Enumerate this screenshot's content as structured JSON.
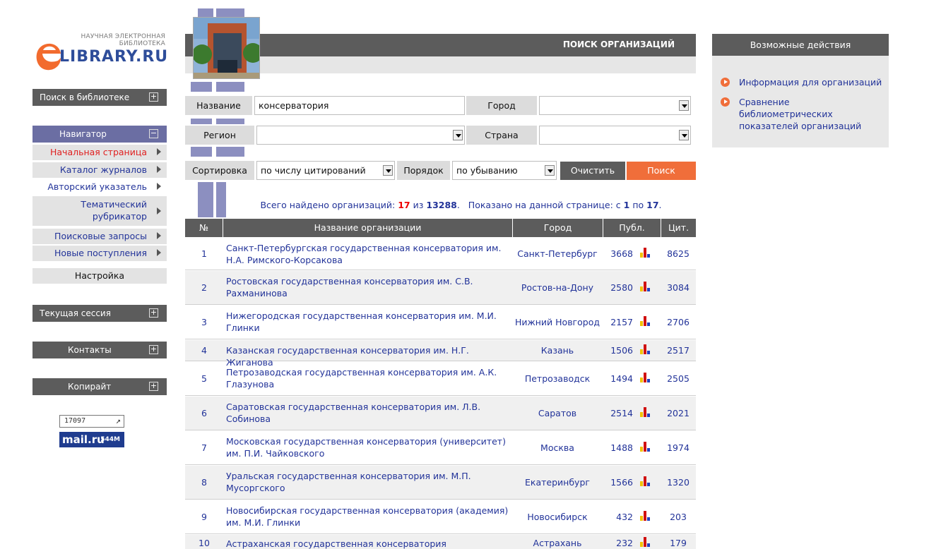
{
  "logo": {
    "small_line1": "НАУЧНАЯ ЭЛЕКТРОННАЯ",
    "small_line2": "БИБЛИОТЕКА",
    "big": "LIBRARY.RU"
  },
  "left_panel": {
    "search_library": "Поиск в библиотеке",
    "navigator": "Навигатор",
    "nav_items": [
      {
        "label": "Начальная страница"
      },
      {
        "label": "Каталог журналов"
      },
      {
        "label": "Авторский указатель"
      },
      {
        "label": "Тематический рубрикатор"
      },
      {
        "label": "Поисковые запросы"
      },
      {
        "label": "Новые поступления"
      }
    ],
    "settings": "Настройка",
    "current_session": "Текущая сессия",
    "contacts": "Контакты",
    "copyright": "Копирайт",
    "counter_value": "17097",
    "mail_logo": "mail.ru",
    "mail_count": "544M"
  },
  "header": {
    "title": "ПОИСК ОРГАНИЗАЦИЙ"
  },
  "form": {
    "name_label": "Название",
    "name_value": "консерватория",
    "city_label": "Город",
    "city_value": "",
    "region_label": "Регион",
    "region_value": "",
    "country_label": "Страна",
    "country_value": "",
    "sort_label": "Сортировка",
    "sort_value": "по числу цитирований",
    "order_label": "Порядок",
    "order_value": "по убыванию",
    "clear_button": "Очистить",
    "search_button": "Поиск"
  },
  "summary": {
    "found_prefix": "Всего найдено организаций:",
    "found_count": "17",
    "of": "из",
    "total": "13288",
    "shown_prefix": "Показано на данной странице: с",
    "from": "1",
    "to_word": "по",
    "to": "17"
  },
  "table": {
    "columns": [
      "№",
      "Название организации",
      "Город",
      "Публ.",
      "Цит."
    ],
    "rows": [
      {
        "num": "1",
        "name": "Санкт-Петербургская государственная консерватория им. Н.А. Римского-Корсакова",
        "city": "Санкт-Петербург",
        "pub": "3668",
        "cit": "8625"
      },
      {
        "num": "2",
        "name": "Ростовская государственная консерватория им. С.В. Рахманинова",
        "city": "Ростов-на-Дону",
        "pub": "2580",
        "cit": "3084"
      },
      {
        "num": "3",
        "name": "Нижегородская государственная консерватория им. М.И. Глинки",
        "city": "Нижний Новгород",
        "pub": "2157",
        "cit": "2706"
      },
      {
        "num": "4",
        "name": "Казанская государственная консерватория им. Н.Г. Жиганова",
        "city": "Казань",
        "pub": "1506",
        "cit": "2517"
      },
      {
        "num": "5",
        "name": "Петрозаводская государственная консерватория им. А.К. Глазунова",
        "city": "Петрозаводск",
        "pub": "1494",
        "cit": "2505"
      },
      {
        "num": "6",
        "name": "Саратовская государственная консерватория им. Л.В. Собинова",
        "city": "Саратов",
        "pub": "2514",
        "cit": "2021"
      },
      {
        "num": "7",
        "name": "Московская государственная консерватория (университет) им. П.И. Чайковского",
        "city": "Москва",
        "pub": "1488",
        "cit": "1974"
      },
      {
        "num": "8",
        "name": "Уральская государственная консерватория им. М.П. Мусоргского",
        "city": "Екатеринбург",
        "pub": "1566",
        "cit": "1320"
      },
      {
        "num": "9",
        "name": "Новосибирская государственная консерватория (академия) им. М.И. Глинки",
        "city": "Новосибирск",
        "pub": "432",
        "cit": "203"
      },
      {
        "num": "10",
        "name": "Астраханская государственная консерватория",
        "city": "Астрахань",
        "pub": "232",
        "cit": "179"
      }
    ]
  },
  "right_panel": {
    "title": "Возможные действия",
    "links": [
      "Информация для организаций",
      "Сравнение библиометрических показателей организаций"
    ]
  },
  "colors": {
    "header_gray": "#5c5c5c",
    "nav_purple": "#6b6ea3",
    "link_blue": "#223399",
    "search_orange": "#f06e3a",
    "accent_red": "#e00000"
  }
}
